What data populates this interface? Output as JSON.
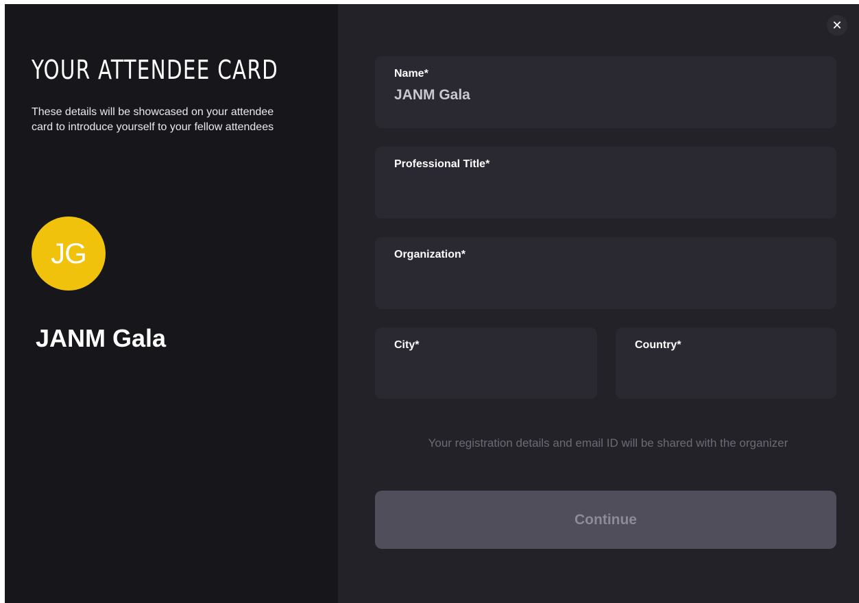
{
  "card": {
    "heading": "YOUR ATTENDEE CARD",
    "description": "These details will be showcased on your attendee card to introduce yourself to your fellow attendees",
    "avatar_initials": "JG",
    "display_name": "JANM Gala"
  },
  "close": {
    "icon": "close-icon",
    "glyph": "✕"
  },
  "form": {
    "name": {
      "label": "Name*",
      "value": "JANM Gala"
    },
    "professional_title": {
      "label": "Professional Title*",
      "value": ""
    },
    "organization": {
      "label": "Organization*",
      "value": ""
    },
    "city": {
      "label": "City*",
      "value": ""
    },
    "country": {
      "label": "Country*",
      "value": ""
    },
    "notice": "Your registration details and email ID will be shared with the organizer",
    "continue_label": "Continue"
  },
  "colors": {
    "left_panel_bg": "#17161b",
    "right_panel_bg": "#232229",
    "field_bg": "#2a2931",
    "avatar_bg": "#f0c20c",
    "continue_bg": "#4f4e5a"
  }
}
